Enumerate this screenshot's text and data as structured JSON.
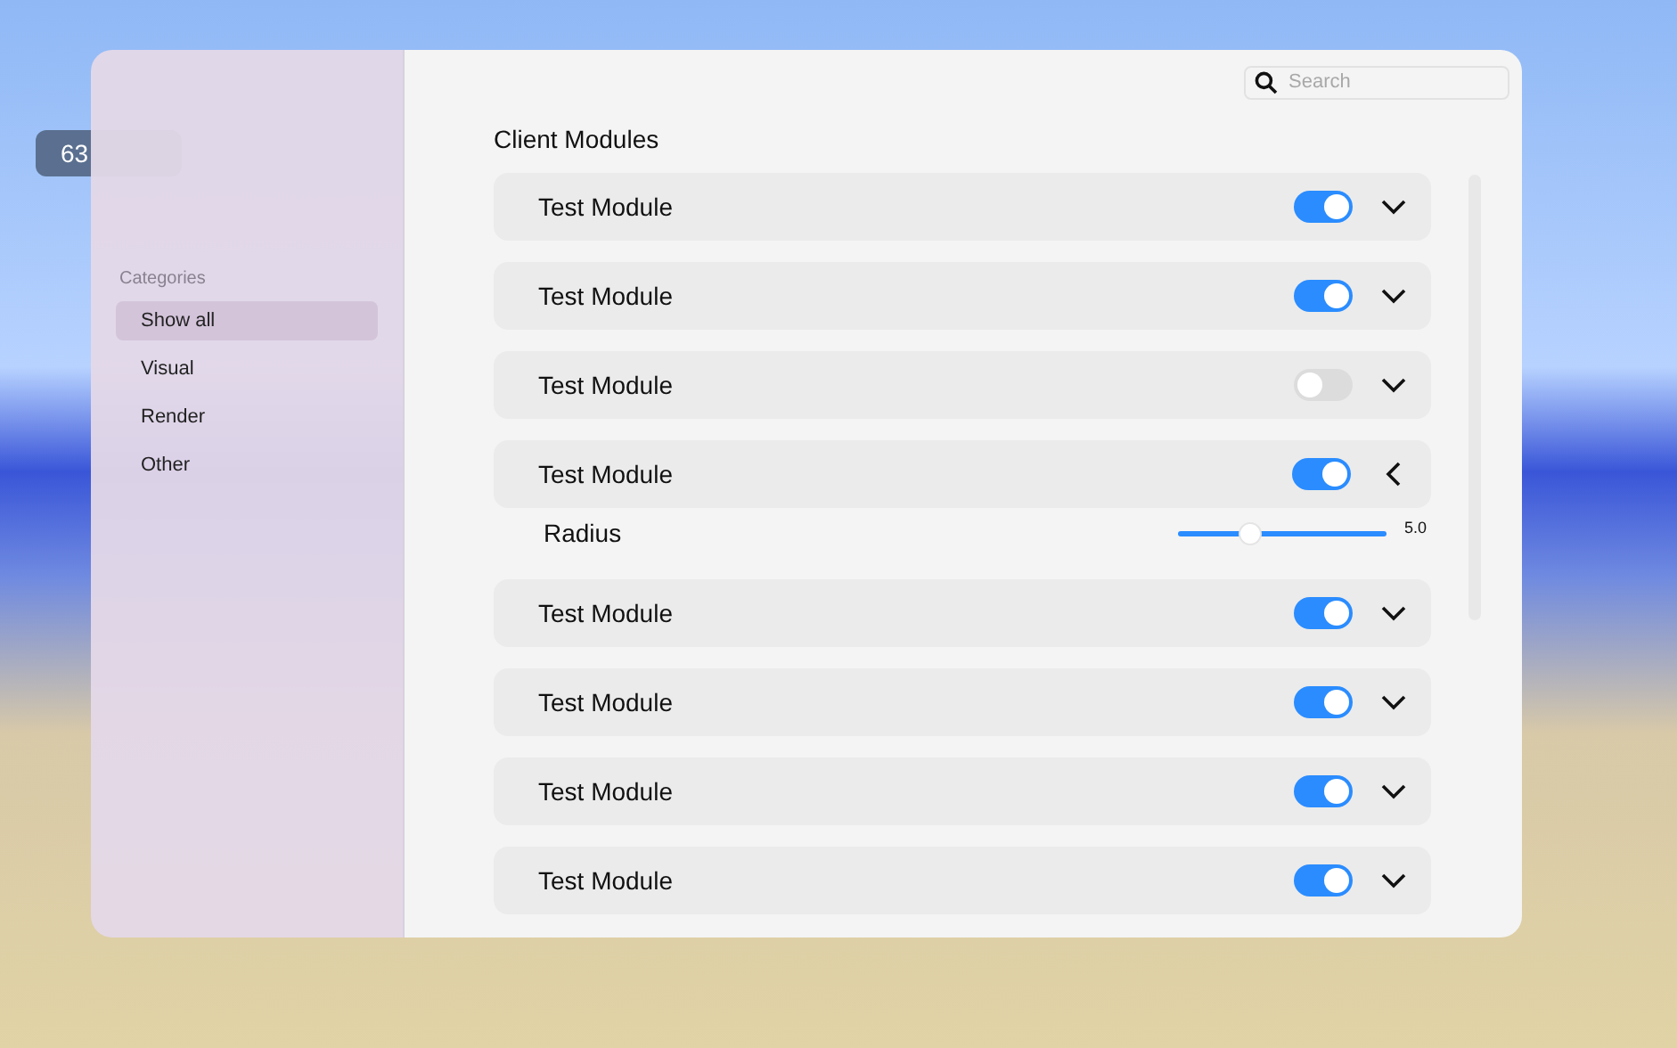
{
  "fps_badge": {
    "text": "63"
  },
  "sidebar": {
    "heading": "Categories",
    "items": [
      {
        "label": "Show all",
        "selected": true
      },
      {
        "label": "Visual",
        "selected": false
      },
      {
        "label": "Render",
        "selected": false
      },
      {
        "label": "Other",
        "selected": false
      }
    ]
  },
  "search": {
    "placeholder": "Search"
  },
  "title": "Client Modules",
  "modules": [
    {
      "name": "Test Module",
      "on": true,
      "expanded": false
    },
    {
      "name": "Test Module",
      "on": true,
      "expanded": false
    },
    {
      "name": "Test Module",
      "on": false,
      "expanded": false
    },
    {
      "name": "Test Module",
      "on": true,
      "expanded": true,
      "settings": [
        {
          "label": "Radius",
          "level": 0.34,
          "reading": "5.0"
        }
      ]
    },
    {
      "name": "Test Module",
      "on": true,
      "expanded": false
    },
    {
      "name": "Test Module",
      "on": true,
      "expanded": false
    },
    {
      "name": "Test Module",
      "on": true,
      "expanded": false
    },
    {
      "name": "Test Module",
      "on": true,
      "expanded": false
    }
  ]
}
